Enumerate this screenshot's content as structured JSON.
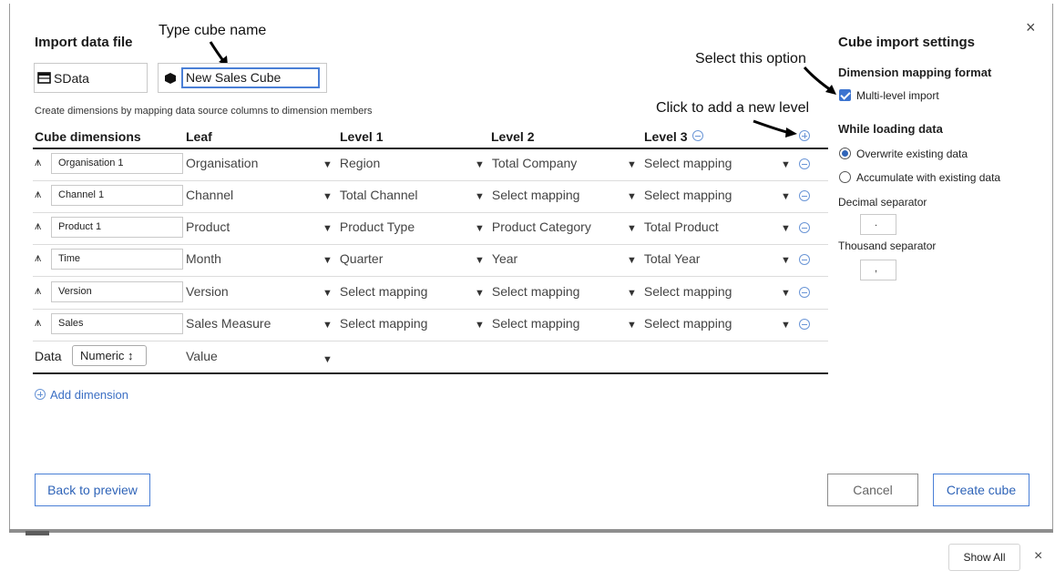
{
  "dialog": {
    "title": "Import data file",
    "source_name": "SData",
    "cube_name": "New Sales Cube",
    "instruction": "Create dimensions by mapping data source columns to dimension members"
  },
  "annotations": {
    "type_cube_name": "Type cube name",
    "select_option": "Select this option",
    "add_level": "Click to add a new level"
  },
  "table": {
    "headers": [
      "Cube dimensions",
      "Leaf",
      "Level 1",
      "Level 2",
      "Level 3"
    ],
    "rows": [
      {
        "dimension": "Organisation 1",
        "leaf": "Organisation",
        "l1": "Region",
        "l2": "Total Company",
        "l3": "Select mapping"
      },
      {
        "dimension": "Channel 1",
        "leaf": "Channel",
        "l1": "Total Channel",
        "l2": "Select mapping",
        "l3": "Select mapping"
      },
      {
        "dimension": "Product 1",
        "leaf": "Product",
        "l1": "Product Type",
        "l2": "Product Category",
        "l3": "Total Product"
      },
      {
        "dimension": "Time",
        "leaf": "Month",
        "l1": "Quarter",
        "l2": "Year",
        "l3": "Total Year"
      },
      {
        "dimension": "Version",
        "leaf": "Version",
        "l1": "Select mapping",
        "l2": "Select mapping",
        "l3": "Select mapping"
      },
      {
        "dimension": "Sales",
        "leaf": "Sales Measure",
        "l1": "Select mapping",
        "l2": "Select mapping",
        "l3": "Select mapping"
      }
    ],
    "data_row": {
      "label": "Data",
      "type": "Numeric ↕",
      "leaf": "Value"
    },
    "add_dimension": "Add dimension"
  },
  "settings": {
    "title": "Cube import settings",
    "mapping_heading": "Dimension mapping format",
    "multi_level": "Multi-level import",
    "loading_heading": "While loading data",
    "overwrite": "Overwrite existing data",
    "accumulate": "Accumulate with existing data",
    "decimal_label": "Decimal separator",
    "decimal_value": ".",
    "thousand_label": "Thousand separator",
    "thousand_value": ","
  },
  "buttons": {
    "back": "Back to preview",
    "cancel": "Cancel",
    "create": "Create cube"
  },
  "footer": {
    "show_all": "Show All"
  },
  "icons": {
    "close": "×",
    "dim": "⩚",
    "tri": "▼"
  }
}
